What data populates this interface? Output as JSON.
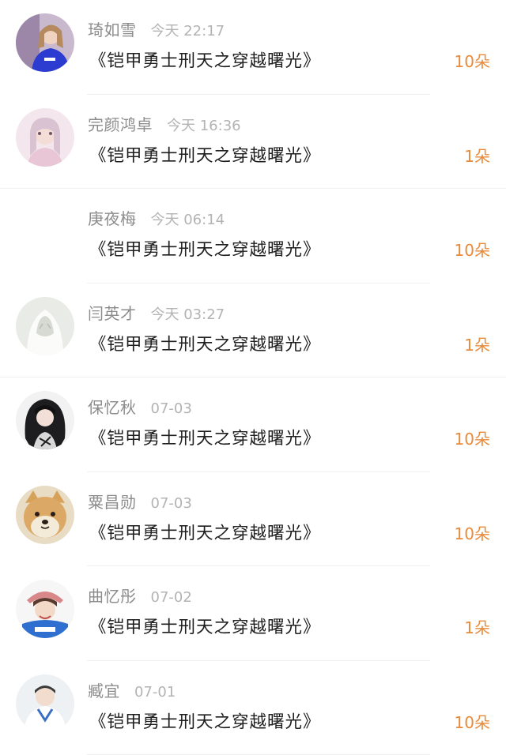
{
  "colors": {
    "name": "#8c8c8c",
    "time": "#b3b3b3",
    "title": "#1f1f1f",
    "count": "#e98a3a",
    "divider": "#f0f0f0"
  },
  "items": [
    {
      "name": "琦如雪",
      "time": "今天 22:17",
      "title": "《铠甲勇士刑天之穿越曙光》",
      "count": "10朵",
      "avatar_icon": "girl-blue-shirt-avatar"
    },
    {
      "name": "完颜鸿卓",
      "time": "今天 16:36",
      "title": "《铠甲勇士刑天之穿越曙光》",
      "count": "1朵",
      "avatar_icon": "girl-pink-avatar"
    },
    {
      "name": "庚夜梅",
      "time": "今天 06:14",
      "title": "《铠甲勇士刑天之穿越曙光》",
      "count": "10朵",
      "avatar_icon": "blank-avatar"
    },
    {
      "name": "闫英才",
      "time": "今天 03:27",
      "title": "《铠甲勇士刑天之穿越曙光》",
      "count": "1朵",
      "avatar_icon": "white-hood-avatar"
    },
    {
      "name": "保忆秋",
      "time": "07-03",
      "title": "《铠甲勇士刑天之穿越曙光》",
      "count": "10朵",
      "avatar_icon": "dark-hair-girl-avatar"
    },
    {
      "name": "粟昌勋",
      "time": "07-03",
      "title": "《铠甲勇士刑天之穿越曙光》",
      "count": "10朵",
      "avatar_icon": "shiba-dog-avatar"
    },
    {
      "name": "曲忆彤",
      "time": "07-02",
      "title": "《铠甲勇士刑天之穿越曙光》",
      "count": "1朵",
      "avatar_icon": "girl-hat-avatar"
    },
    {
      "name": "臧宜",
      "time": "07-01",
      "title": "《铠甲勇士刑天之穿越曙光》",
      "count": "10朵",
      "avatar_icon": "boy-hoodie-avatar"
    }
  ]
}
